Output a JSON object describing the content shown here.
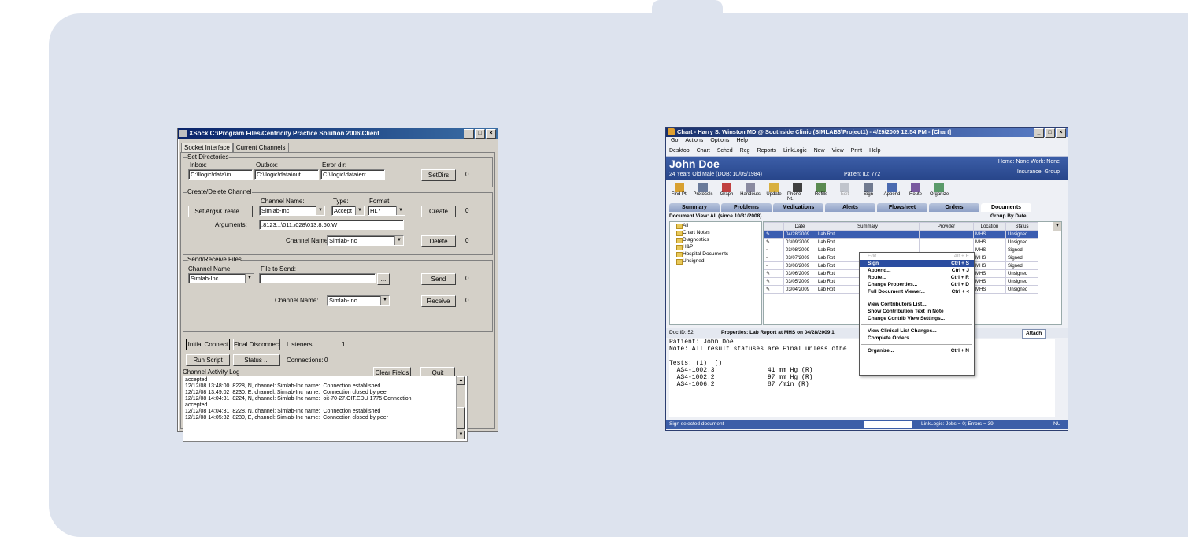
{
  "xsock": {
    "title": "XSock C:\\Program Files\\Centricity Practice Solution 2006\\Client",
    "tabs": [
      "Socket Interface",
      "Current Channels"
    ],
    "set_dirs": {
      "legend": "Set Directories",
      "inbox_label": "Inbox:",
      "inbox_value": "C:\\llogic\\data\\in",
      "outbox_label": "Outbox:",
      "outbox_value": "C:\\llogic\\data\\out",
      "error_label": "Error dir:",
      "error_value": "C:\\llogic\\data\\err",
      "button": "SetDirs",
      "count": "0"
    },
    "create_delete": {
      "legend": "Create/Delete Channel",
      "set_args_button": "Set Args/Create ...",
      "channel_name_label": "Channel Name:",
      "channel_name_value": "Simlab-Inc",
      "type_label": "Type:",
      "type_value": "Accept",
      "format_label": "Format:",
      "format_value": "HL7",
      "create_button": "Create",
      "create_count": "0",
      "arguments_label": "Arguments:",
      "arguments_value": ".8123...\\011.\\028\\013.8.60.W",
      "channel_name2_label": "Channel Name:",
      "channel_name2_value": "Simlab-Inc",
      "delete_button": "Delete",
      "delete_count": "0"
    },
    "send_receive": {
      "legend": "Send/Receive Files",
      "channel_name_label": "Channel Name:",
      "channel_name_value": "Simlab-Inc",
      "file_label": "File to Send:",
      "file_value": "",
      "browse_button": "...",
      "send_button": "Send",
      "send_count": "0",
      "channel_name2_label": "Channel Name:",
      "channel_name2_value": "Simlab-Inc",
      "receive_button": "Receive",
      "receive_count": "0"
    },
    "controls": {
      "initial_connect": "Initial Connect",
      "final_disconnect": "Final Disconnect",
      "listeners_label": "Listeners:",
      "listeners_value": "1",
      "run_script": "Run Script",
      "status": "Status ...",
      "connections_label": "Connections:",
      "connections_value": "0",
      "clear_fields": "Clear Fields",
      "quit": "Quit"
    },
    "log_label": "Channel Activity Log",
    "log_text": "accepted\n12/12/08 13:48:00  8228, N, channel: Simlab-Inc name:  Connection established\n12/12/08 13:49:02  8230, E, channel: Simlab-Inc name:  Connection closed by peer\n12/12/08 14:04:31  8224, N, channel: Simlab-Inc name:  oit-70-27.OIT.EDU 1775 Connection\naccepted\n12/12/08 14:04:31  8228, N, channel: Simlab-Inc name:  Connection established\n12/12/08 14:05:32  8230, E, channel: Simlab-Inc name:  Connection closed by peer"
  },
  "chart": {
    "title": "Chart - Harry S. Winston MD @ Southside Clinic (SIMLAB3\\Project1) - 4/29/2009 12:54 PM - [Chart]",
    "menu": [
      "Go",
      "Actions",
      "Options",
      "Help"
    ],
    "toolbar": [
      "Desktop",
      "Chart",
      "Sched",
      "Reg",
      "Reports",
      "LinkLogic",
      "New",
      "View",
      "Print",
      "Help"
    ],
    "patient": {
      "name": "John Doe",
      "info": "24 Years Old Male (DOB: 10/09/1984)",
      "id": "Patient ID: 772",
      "right1": "Home: None  Work: None",
      "right2": "Insurance: Group"
    },
    "icons": [
      "Find Pt.",
      "Protocols",
      "Graph",
      "Handouts",
      "Update",
      "Phone Nt.",
      "Refills",
      "Edit",
      "Sign",
      "Append",
      "Route",
      "Organize"
    ],
    "tabs": [
      "Summary",
      "Problems",
      "Medications",
      "Alerts",
      "Flowsheet",
      "Orders",
      "Documents"
    ],
    "document_view": "Document View:  All (since 10/31/2008)",
    "group_by": "Group By Date",
    "tree": [
      "All",
      "Chart Notes",
      "Diagnostics",
      "H&P",
      "Hospital Documents",
      "Unsigned"
    ],
    "grid_headers": [
      "Date",
      "Summary",
      "Provider",
      "Location",
      "Status"
    ],
    "grid_rows": [
      [
        "04/28/2009",
        "Lab Rpt",
        "MHS",
        "Unsigned"
      ],
      [
        "03/09/2009",
        "Lab Rpt",
        "MHS",
        "Unsigned"
      ],
      [
        "03/08/2009",
        "Lab Rpt",
        "MHS",
        "Signed"
      ],
      [
        "03/07/2009",
        "Lab Rpt",
        "MHS",
        "Signed"
      ],
      [
        "03/06/2009",
        "Lab Rpt",
        "MHS",
        "Signed"
      ],
      [
        "03/06/2009",
        "Lab Rpt",
        "MHS",
        "Unsigned"
      ],
      [
        "03/05/2009",
        "Lab Rpt",
        "MHS",
        "Unsigned"
      ],
      [
        "03/04/2009",
        "Lab Rpt",
        "MHS",
        "Unsigned"
      ]
    ],
    "context_menu": [
      {
        "label": "Edit",
        "key": "Alt + E",
        "disabled": true
      },
      {
        "label": "Sign",
        "key": "Ctrl + S",
        "highlight": true
      },
      {
        "label": "Append...",
        "key": "Ctrl + J"
      },
      {
        "label": "Route...",
        "key": "Ctrl + R"
      },
      {
        "label": "Change Properties...",
        "key": "Ctrl + D"
      },
      {
        "label": "Full Document Viewer...",
        "key": "Ctrl + <"
      },
      {
        "sep": true
      },
      {
        "label": "View Contributors List...",
        "key": ""
      },
      {
        "label": "Show Contribution Text in Note",
        "key": ""
      },
      {
        "label": "Change Contrib View Settings...",
        "key": ""
      },
      {
        "sep": true
      },
      {
        "label": "View Clinical List Changes...",
        "key": ""
      },
      {
        "label": "Complete Orders...",
        "key": ""
      },
      {
        "sep": true
      },
      {
        "label": "Organize...",
        "key": "Ctrl + N"
      }
    ],
    "doc_id": "Doc ID: 52",
    "properties": "Properties:  Lab Report at MHS on 04/28/2009 1",
    "attach": "Attach",
    "note_text": "Patient: John Doe\nNote: All result statuses are Final unless othe\n\nTests: (1)  ()\n  AS4-1002.3              41 mm Hg (R)\n  AS4-1002.2              97 mm Hg (R)\n  AS4-1006.2              87 /min (R)",
    "status_left": "Sign selected document",
    "status_right": "LinkLogic: Jobs = 0; Errors = 39",
    "status_nu": "NU"
  }
}
